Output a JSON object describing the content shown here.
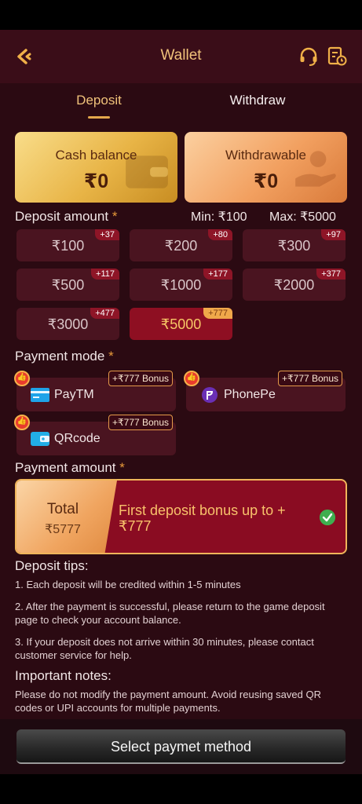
{
  "header": {
    "title": "Wallet"
  },
  "tabs": [
    {
      "label": "Deposit",
      "active": true
    },
    {
      "label": "Withdraw",
      "active": false
    }
  ],
  "balances": {
    "cash": {
      "label": "Cash balance",
      "value": "₹0"
    },
    "withdrawable": {
      "label": "Withdrawable",
      "value": "₹0"
    }
  },
  "deposit": {
    "label": "Deposit amount",
    "required_mark": "*",
    "min": "Min: ₹100",
    "max": "Max: ₹5000",
    "amounts": [
      {
        "value": "₹100",
        "bonus": "+37"
      },
      {
        "value": "₹200",
        "bonus": "+80"
      },
      {
        "value": "₹300",
        "bonus": "+97"
      },
      {
        "value": "₹500",
        "bonus": "+117"
      },
      {
        "value": "₹1000",
        "bonus": "+177"
      },
      {
        "value": "₹2000",
        "bonus": "+377"
      },
      {
        "value": "₹3000",
        "bonus": "+477"
      },
      {
        "value": "₹5000",
        "bonus": "+777",
        "selected": true
      }
    ]
  },
  "payment_mode": {
    "label": "Payment mode",
    "required_mark": "*",
    "methods": [
      {
        "name": "PayTM",
        "bonus": "+₹777 Bonus"
      },
      {
        "name": "PhonePe",
        "bonus": "+₹777 Bonus"
      },
      {
        "name": "QRcode",
        "bonus": "+₹777 Bonus"
      }
    ]
  },
  "payment_amount": {
    "label": "Payment amount",
    "required_mark": "*",
    "total_label": "Total",
    "total_value": "₹5777",
    "first_bonus": "First deposit bonus up to +₹777"
  },
  "tips": {
    "title": "Deposit tips:",
    "items": [
      "1. Each deposit will be credited within 1-5 minutes",
      "2. After the payment is successful, please return to the game deposit page to check your account balance.",
      "3. If your deposit does not arrive within 30 minutes, please contact customer service for help."
    ]
  },
  "notes": {
    "title": "Important notes:",
    "text": "Please do not modify the payment amount. Avoid reusing saved QR codes or UPI accounts for multiple payments."
  },
  "bottom": {
    "button_label": "Select paymet method"
  },
  "colors": {
    "accent": "#f0c27a",
    "background": "#2b0a12",
    "selected": "#8e0f22"
  }
}
